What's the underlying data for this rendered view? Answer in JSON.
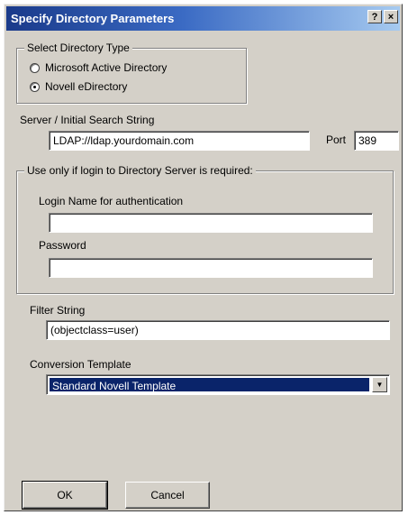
{
  "dialog": {
    "title": "Specify Directory Parameters",
    "help_button": "?",
    "close_button": "×"
  },
  "directory_type": {
    "legend": "Select Directory Type",
    "options": [
      {
        "label": "Microsoft Active Directory",
        "checked": false
      },
      {
        "label": "Novell eDirectory",
        "checked": true
      }
    ]
  },
  "server": {
    "label": "Server / Initial Search String",
    "value": "LDAP://ldap.yourdomain.com",
    "port_label": "Port",
    "port_value": "389"
  },
  "login": {
    "legend": "Use only if login to Directory Server is required:",
    "name_label": "Login Name for authentication",
    "name_value": "",
    "password_label": "Password",
    "password_value": ""
  },
  "filter": {
    "label": "Filter String",
    "value": "(objectclass=user)"
  },
  "conversion": {
    "label": "Conversion Template",
    "selected": "Standard Novell Template"
  },
  "buttons": {
    "ok": "OK",
    "cancel": "Cancel"
  }
}
